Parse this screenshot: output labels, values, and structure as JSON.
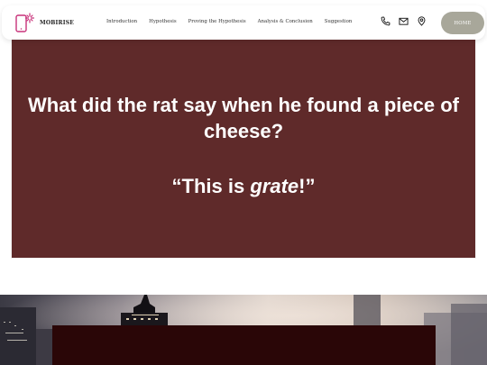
{
  "brand": {
    "name": "MOBIRISE",
    "logo_icon": "phone-sparkle-icon",
    "accent_color": "#c8327a"
  },
  "nav": {
    "links": [
      {
        "label": "Introduction"
      },
      {
        "label": "Hypothesis"
      },
      {
        "label": "Proving the Hypothesis"
      },
      {
        "label": "Analysis & Conclusion"
      },
      {
        "label": "Suggestion"
      }
    ],
    "icons": [
      "phone-icon",
      "mail-icon",
      "location-pin-icon"
    ],
    "home_button": "HOME"
  },
  "joke": {
    "question": "What did the rat say when he found a piece of cheese?",
    "answer_prefix": "“This is ",
    "answer_emphasis": "grate",
    "answer_suffix": "!”",
    "background_color": "#5f2a2a"
  },
  "lower_section": {
    "panel_color": "#2a0607"
  }
}
